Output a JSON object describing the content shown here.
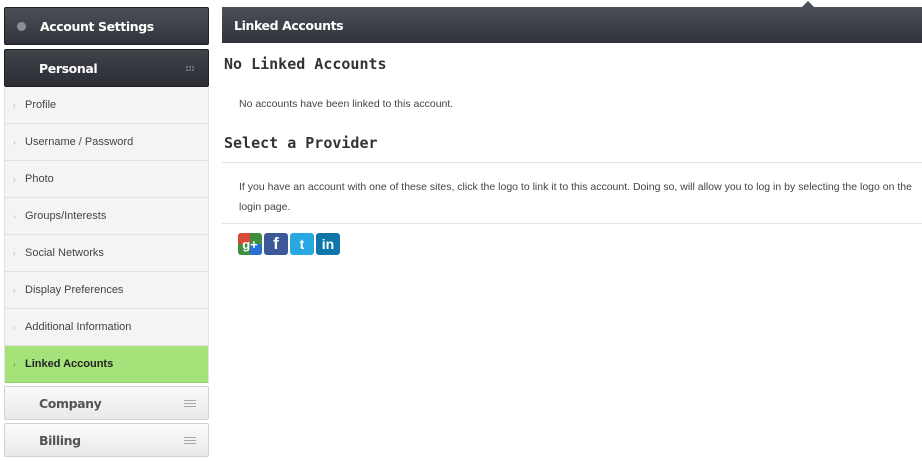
{
  "sidebar": {
    "header": {
      "label": "Account Settings"
    },
    "personal": {
      "label": "Personal",
      "items": [
        {
          "label": "Profile",
          "active": false
        },
        {
          "label": "Username / Password",
          "active": false
        },
        {
          "label": "Photo",
          "active": false
        },
        {
          "label": "Groups/Interests",
          "active": false
        },
        {
          "label": "Social Networks",
          "active": false
        },
        {
          "label": "Display Preferences",
          "active": false
        },
        {
          "label": "Additional Information",
          "active": false
        },
        {
          "label": "Linked Accounts",
          "active": true
        }
      ]
    },
    "company": {
      "label": "Company"
    },
    "billing": {
      "label": "Billing"
    }
  },
  "main": {
    "header": "Linked Accounts",
    "linked": {
      "title": "No Linked Accounts",
      "message": "No accounts have been linked to this account."
    },
    "provider": {
      "title": "Select a Provider",
      "description": "If you have an account with one of these sites, click the logo to link it to this account. Doing so, will allow you to log in by selecting the logo on the login page.",
      "providers": [
        {
          "icon": "google-plus-icon",
          "glyph": "g+",
          "color": "#3f8f3f"
        },
        {
          "icon": "facebook-icon",
          "glyph": "f",
          "color": "#3b5998"
        },
        {
          "icon": "twitter-icon",
          "glyph": "t",
          "color": "#29a9e1"
        },
        {
          "icon": "linkedin-icon",
          "glyph": "in",
          "color": "#0e76a8"
        }
      ]
    }
  },
  "colors": {
    "active_item": "#a5e27a",
    "header_dark": "#30333a"
  }
}
